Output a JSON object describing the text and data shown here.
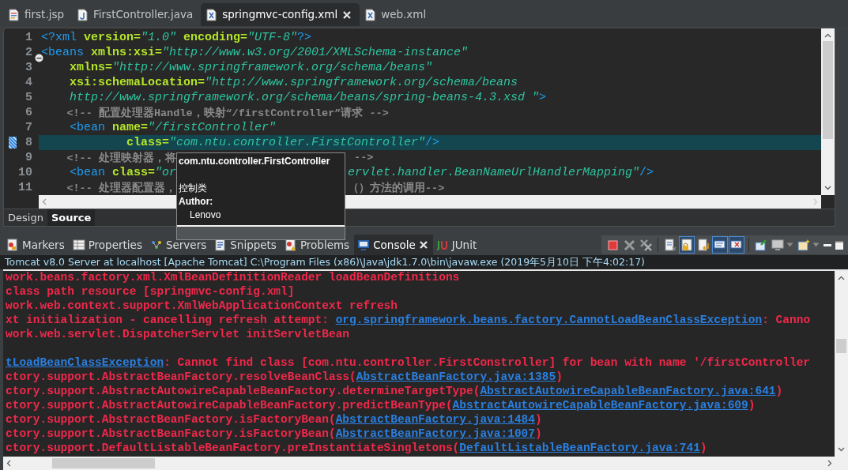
{
  "editor_tabs": [
    {
      "label": "first.jsp",
      "kind": "jsp",
      "selected": false,
      "closable": false
    },
    {
      "label": "FirstController.java",
      "kind": "java",
      "selected": false,
      "closable": false
    },
    {
      "label": "springmvc-config.xml",
      "kind": "xml",
      "selected": true,
      "closable": true
    },
    {
      "label": "web.xml",
      "kind": "xml",
      "selected": false,
      "closable": false
    }
  ],
  "code_lines": [
    {
      "number": "1",
      "current": false,
      "collapsible": false,
      "tokens": [
        {
          "kind": "tag",
          "s": "<?xml"
        },
        {
          "kind": "attr",
          "s": " version="
        },
        {
          "kind": "value",
          "s": "\"1.0\""
        },
        {
          "kind": "attr",
          "s": " encoding="
        },
        {
          "kind": "value",
          "s": "\"UTF-8\""
        },
        {
          "kind": "tag",
          "s": "?>"
        }
      ]
    },
    {
      "number": "2",
      "current": false,
      "collapsible": true,
      "tokens": [
        {
          "kind": "tag",
          "s": "<beans"
        },
        {
          "kind": "attr",
          "s": " xmlns:xsi="
        },
        {
          "kind": "value",
          "s": "\"http://www.w3.org/2001/XMLSchema-instance\""
        }
      ]
    },
    {
      "number": "3",
      "current": false,
      "collapsible": false,
      "tokens": [
        {
          "kind": "attr",
          "s": "    xmlns="
        },
        {
          "kind": "value",
          "s": "\"http://www.springframework.org/schema/beans\""
        }
      ]
    },
    {
      "number": "4",
      "current": false,
      "collapsible": false,
      "tokens": [
        {
          "kind": "attr",
          "s": "    xsi:schemaLocation="
        },
        {
          "kind": "value",
          "s": "\"http://www.springframework.org/schema/beans"
        }
      ]
    },
    {
      "number": "5",
      "current": false,
      "collapsible": false,
      "tokens": [
        {
          "kind": "value",
          "s": "    http://www.springframework.org/schema/beans/spring-beans-4.3.xsd \""
        },
        {
          "kind": "tag",
          "s": ">"
        }
      ]
    },
    {
      "number": "6",
      "current": false,
      "collapsible": false,
      "tokens": [
        {
          "kind": "comment",
          "s": "    <!-- 配置处理器Handle，映射“/firstController”请求 -->"
        }
      ]
    },
    {
      "number": "7",
      "current": false,
      "collapsible": false,
      "tokens": [
        {
          "kind": "tag",
          "s": "    <bean"
        },
        {
          "kind": "attr",
          "s": " name="
        },
        {
          "kind": "value",
          "s": "\"/firstController\""
        }
      ]
    },
    {
      "number": "8",
      "current": true,
      "collapsible": false,
      "tokens": [
        {
          "kind": "attr",
          "s": "            class="
        },
        {
          "kind": "value",
          "s": "\"com.ntu.controller.FirstController\""
        },
        {
          "kind": "tag",
          "s": "/>"
        }
      ]
    },
    {
      "number": "9",
      "current": false,
      "collapsible": false,
      "tokens": [
        {
          "kind": "comment",
          "s": "    <!-- 处理映射器，将"
        }
      ],
      "resume": [
        {
          "kind": "comment",
          "s": " -->"
        }
      ]
    },
    {
      "number": "10",
      "current": false,
      "collapsible": false,
      "tokens": [
        {
          "kind": "tag",
          "s": "    <bean"
        },
        {
          "kind": "attr",
          "s": " class="
        },
        {
          "kind": "value",
          "s": "\"or"
        }
      ],
      "resume": [
        {
          "kind": "value",
          "s": "ervlet.handler.BeanNameUrlHandlerMapping\""
        },
        {
          "kind": "tag",
          "s": "/>"
        }
      ]
    },
    {
      "number": "11",
      "current": false,
      "collapsible": false,
      "tokens": [
        {
          "kind": "comment",
          "s": "    <!-- 处理器配置器，"
        }
      ],
      "resume": [
        {
          "kind": "comment",
          "s": "（）方法的调用-->"
        }
      ]
    }
  ],
  "source_tabs": [
    {
      "label": "Design",
      "selected": false
    },
    {
      "label": "Source",
      "selected": true
    }
  ],
  "tooltip": {
    "title": "com.ntu.controller.FirstController",
    "description": "控制类",
    "author_label": "Author:",
    "author": "Lenovo"
  },
  "view_tabs": [
    {
      "label": "Markers",
      "kind": "markers",
      "selected": false,
      "closable": false
    },
    {
      "label": "Properties",
      "kind": "properties",
      "selected": false,
      "closable": false
    },
    {
      "label": "Servers",
      "kind": "servers",
      "selected": false,
      "closable": false
    },
    {
      "label": "Snippets",
      "kind": "snippets",
      "selected": false,
      "closable": false
    },
    {
      "label": "Problems",
      "kind": "problems",
      "selected": false,
      "closable": false
    },
    {
      "label": "Console",
      "kind": "console",
      "selected": true,
      "closable": true
    },
    {
      "label": "JUnit",
      "kind": "junit",
      "selected": false,
      "closable": false
    }
  ],
  "toolbar_groups": [
    [
      {
        "kind": "terminate",
        "toggled": false,
        "dropdown": false
      },
      {
        "kind": "remove",
        "toggled": false,
        "dropdown": false
      },
      {
        "kind": "remove-all",
        "toggled": false,
        "dropdown": false
      }
    ],
    [
      {
        "kind": "clear",
        "toggled": false,
        "dropdown": false
      },
      {
        "kind": "scroll-lock",
        "toggled": true,
        "dropdown": false
      },
      {
        "kind": "word-wrap",
        "toggled": false,
        "dropdown": false
      },
      {
        "kind": "stdout",
        "toggled": true,
        "dropdown": false
      },
      {
        "kind": "stderr",
        "toggled": true,
        "dropdown": false
      }
    ],
    [
      {
        "kind": "pin",
        "toggled": false,
        "dropdown": false
      },
      {
        "kind": "display",
        "toggled": false,
        "dropdown": true
      },
      {
        "kind": "open",
        "toggled": false,
        "dropdown": true
      },
      {
        "kind": "minimize",
        "toggled": false,
        "dropdown": false
      },
      {
        "kind": "maximize",
        "toggled": false,
        "dropdown": false
      }
    ]
  ],
  "console": {
    "title": "Tomcat v8.0 Server at localhost [Apache Tomcat] C:\\Program Files (x86)\\Java\\jdk1.7.0\\bin\\javaw.exe (2019年5月10日 下午4:02:17)",
    "lines": [
      {
        "kind": "text",
        "segments": [
          {
            "s": "work.beans.factory.xml.XmlBeanDefinitionReader loadBeanDefinitions",
            "link": false
          }
        ]
      },
      {
        "kind": "text",
        "segments": [
          {
            "s": "class path resource [springmvc-config.xml]",
            "link": false
          }
        ]
      },
      {
        "kind": "text",
        "segments": [
          {
            "s": "work.web.context.support.XmlWebApplicationContext refresh",
            "link": false
          }
        ]
      },
      {
        "kind": "text",
        "segments": [
          {
            "s": "xt initialization - cancelling refresh attempt: ",
            "link": false
          },
          {
            "s": "org.springframework.beans.factory.CannotLoadBeanClassException",
            "link": true
          },
          {
            "s": ": Canno",
            "link": false
          }
        ]
      },
      {
        "kind": "text",
        "segments": [
          {
            "s": "work.web.servlet.DispatcherServlet initServletBean",
            "link": false
          }
        ]
      },
      {
        "kind": "blank"
      },
      {
        "kind": "text",
        "segments": [
          {
            "s": "tLoadBeanClassException",
            "link": true
          },
          {
            "s": ": Cannot find class [com.ntu.controller.FirstConstroller] for bean with name '/firstController",
            "link": false
          }
        ]
      },
      {
        "kind": "text",
        "segments": [
          {
            "s": "ctory.support.AbstractBeanFactory.resolveBeanClass(",
            "link": false
          },
          {
            "s": "AbstractBeanFactory.java:1385",
            "link": true
          },
          {
            "s": ")",
            "link": false
          }
        ]
      },
      {
        "kind": "text",
        "segments": [
          {
            "s": "ctory.support.AbstractAutowireCapableBeanFactory.determineTargetType(",
            "link": false
          },
          {
            "s": "AbstractAutowireCapableBeanFactory.java:641",
            "link": true
          },
          {
            "s": ")",
            "link": false
          }
        ]
      },
      {
        "kind": "text",
        "segments": [
          {
            "s": "ctory.support.AbstractAutowireCapableBeanFactory.predictBeanType(",
            "link": false
          },
          {
            "s": "AbstractAutowireCapableBeanFactory.java:609",
            "link": true
          },
          {
            "s": ")",
            "link": false
          }
        ]
      },
      {
        "kind": "text",
        "segments": [
          {
            "s": "ctory.support.AbstractBeanFactory.isFactoryBean(",
            "link": false
          },
          {
            "s": "AbstractBeanFactory.java:1484",
            "link": true
          },
          {
            "s": ")",
            "link": false
          }
        ]
      },
      {
        "kind": "text",
        "segments": [
          {
            "s": "ctory.support.AbstractBeanFactory.isFactoryBean(",
            "link": false
          },
          {
            "s": "AbstractBeanFactory.java:1007",
            "link": true
          },
          {
            "s": ")",
            "link": false
          }
        ]
      },
      {
        "kind": "text",
        "segments": [
          {
            "s": "ctory.support.DefaultListableBeanFactory.preInstantiateSingletons(",
            "link": false
          },
          {
            "s": "DefaultListableBeanFactory.java:741",
            "link": true
          },
          {
            "s": ")",
            "link": false
          }
        ]
      }
    ]
  }
}
